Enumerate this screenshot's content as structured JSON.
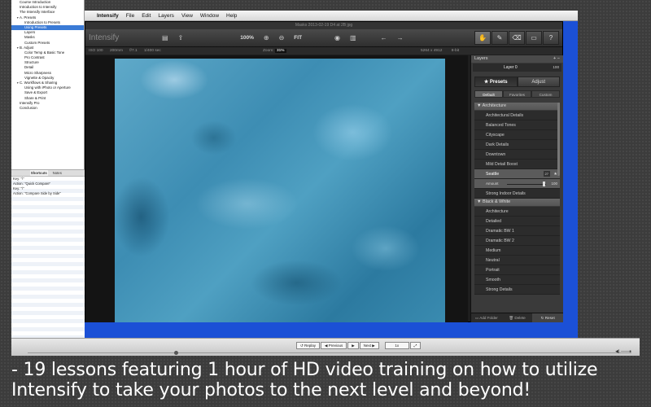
{
  "outline": {
    "items": [
      {
        "label": "Course Introduction",
        "indent": 0,
        "tri": ""
      },
      {
        "label": "Introduction to Intensify",
        "indent": 0,
        "tri": ""
      },
      {
        "label": "The Intensify Interface",
        "indent": 0,
        "tri": ""
      },
      {
        "label": "A. Presets",
        "indent": 0,
        "tri": "▼"
      },
      {
        "label": "Introduction to Presets",
        "indent": 1,
        "tri": ""
      },
      {
        "label": "Using Presets",
        "indent": 1,
        "tri": "",
        "selected": true
      },
      {
        "label": "Layers",
        "indent": 1,
        "tri": ""
      },
      {
        "label": "Masks",
        "indent": 1,
        "tri": ""
      },
      {
        "label": "Custom Presets",
        "indent": 1,
        "tri": ""
      },
      {
        "label": "B. Adjust",
        "indent": 0,
        "tri": "▼"
      },
      {
        "label": "Color Temp & Basic Tone",
        "indent": 1,
        "tri": ""
      },
      {
        "label": "Pro Contrast",
        "indent": 1,
        "tri": ""
      },
      {
        "label": "Structure",
        "indent": 1,
        "tri": ""
      },
      {
        "label": "Detail",
        "indent": 1,
        "tri": ""
      },
      {
        "label": "Micro Sharpness",
        "indent": 1,
        "tri": ""
      },
      {
        "label": "Vignette & Opacity",
        "indent": 1,
        "tri": ""
      },
      {
        "label": "C. Workflows & Sharing",
        "indent": 0,
        "tri": "▼"
      },
      {
        "label": "Using with iPhoto or Aperture",
        "indent": 1,
        "tri": ""
      },
      {
        "label": "Save & Export",
        "indent": 1,
        "tri": ""
      },
      {
        "label": "Share & Print",
        "indent": 1,
        "tri": ""
      },
      {
        "label": "Intensify Pro",
        "indent": 0,
        "tri": ""
      },
      {
        "label": "Conclusion",
        "indent": 0,
        "tri": ""
      }
    ]
  },
  "notes": {
    "tabs": [
      "",
      "Shortcuts",
      "Notes",
      ""
    ],
    "lines": [
      "Key: \"\\\"",
      "Action: \"Quick Compare\"",
      "Key: \"/\"",
      "Action: \"Compare Side by Side\""
    ]
  },
  "menubar": {
    "apple": "",
    "app": "Intensify",
    "items": [
      "File",
      "Edit",
      "Layers",
      "View",
      "Window",
      "Help"
    ]
  },
  "window": {
    "title": "Masks 2013-02-19 D4 at 2B jpg",
    "brand": "Intensify",
    "zoom_pct": "100%",
    "fit": "FIT",
    "tools": [
      "✋",
      "✎",
      "⌫",
      "▭",
      "?"
    ]
  },
  "info": {
    "iso": "ISO 100",
    "focal": "200mm",
    "aperture": "f/7.1",
    "shutter": "1/400 sec",
    "zoom_label": "Zoom:",
    "zoom_value": "31%",
    "dims": "5264 x 4912",
    "bit": "8-bit"
  },
  "layers": {
    "title": "Layers",
    "layer_name": "Layer 0",
    "layer_opacity": "100",
    "tabs": {
      "presets": "★ Presets",
      "adjust": "Adjust"
    },
    "subtabs": [
      "Default",
      "Favorites",
      "Custom"
    ],
    "categories": [
      {
        "name": "Architecture",
        "items": [
          "Architectural Details",
          "Balanced Tones",
          "Cityscape",
          "Dark Details",
          "Downtown",
          "Mild Detail Boost"
        ]
      }
    ],
    "selected_preset": {
      "name": "Seattle",
      "badge": "27"
    },
    "amount": {
      "label": "Amount",
      "value": "100"
    },
    "after_selected": [
      "Strong Indoor Details"
    ],
    "bw": {
      "name": "Black & White",
      "items": [
        "Architecture",
        "Detailed",
        "Dramatic BW 1",
        "Dramatic BW 2",
        "Medium",
        "Neutral",
        "Portrait",
        "Smooth",
        "Strong Details"
      ]
    },
    "footer": {
      "add": "Add Folder",
      "delete": "Delete",
      "reset": "Reset"
    }
  },
  "video": {
    "replay": "Replay",
    "previous": "Previous",
    "next": "Next",
    "speed": "1x"
  },
  "caption": {
    "line1": "- 19 lessons featuring 1 hour of HD video training on how to utilize",
    "line2": "Intensify to take your photos to the next level and beyond!"
  }
}
